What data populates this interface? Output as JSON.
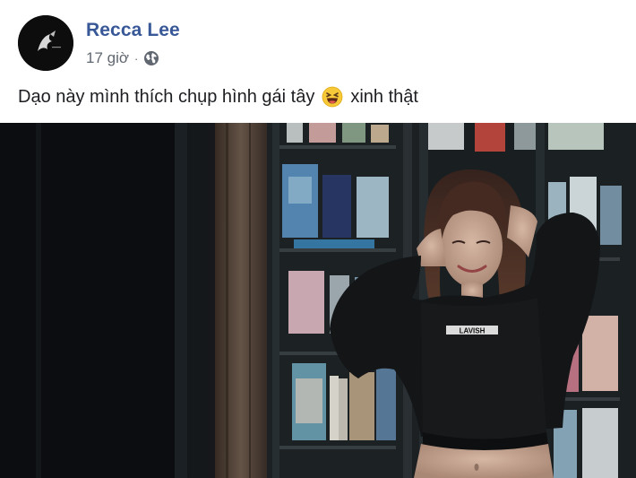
{
  "post": {
    "author_name": "Recca Lee",
    "timestamp": "17 giờ",
    "separator": "·",
    "privacy_icon": "globe-icon",
    "caption_before": "Dạo này mình thích chụp hình gái tây",
    "caption_emoji": "laughing-face-icon",
    "caption_after": "xinh thật",
    "photo_shirt_text": "LAVISH"
  },
  "colors": {
    "author_link": "#385898",
    "meta_text": "#616770",
    "body_text": "#1c1e21"
  }
}
